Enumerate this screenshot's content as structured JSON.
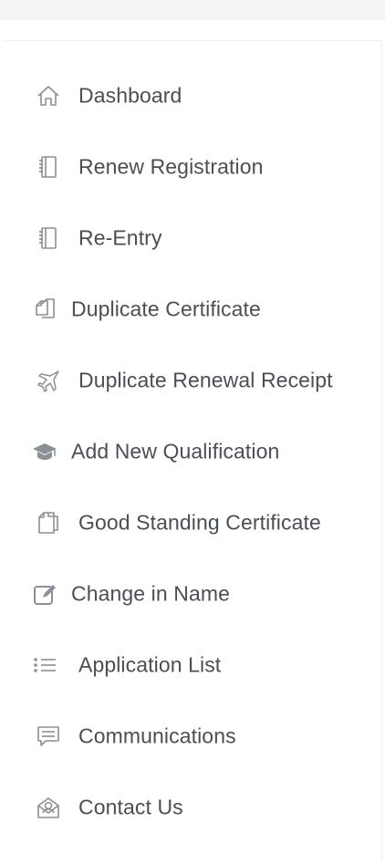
{
  "nav": {
    "items": [
      {
        "label": "Dashboard",
        "icon": "home-icon"
      },
      {
        "label": "Renew Registration",
        "icon": "notebook-icon"
      },
      {
        "label": "Re-Entry",
        "icon": "notebook-icon"
      },
      {
        "label": "Duplicate Certificate",
        "icon": "copy-icon"
      },
      {
        "label": "Duplicate Renewal Receipt",
        "icon": "plane-icon"
      },
      {
        "label": "Add New Qualification",
        "icon": "graduation-cap-icon"
      },
      {
        "label": "Good Standing Certificate",
        "icon": "document-icon"
      },
      {
        "label": "Change in Name",
        "icon": "edit-icon"
      },
      {
        "label": "Application List",
        "icon": "list-icon"
      },
      {
        "label": "Communications",
        "icon": "chat-icon"
      },
      {
        "label": "Contact Us",
        "icon": "contact-icon"
      }
    ]
  },
  "colors": {
    "text": "#4a4f55",
    "icon": "#8a9096",
    "highlight": "#0b3d6b"
  }
}
